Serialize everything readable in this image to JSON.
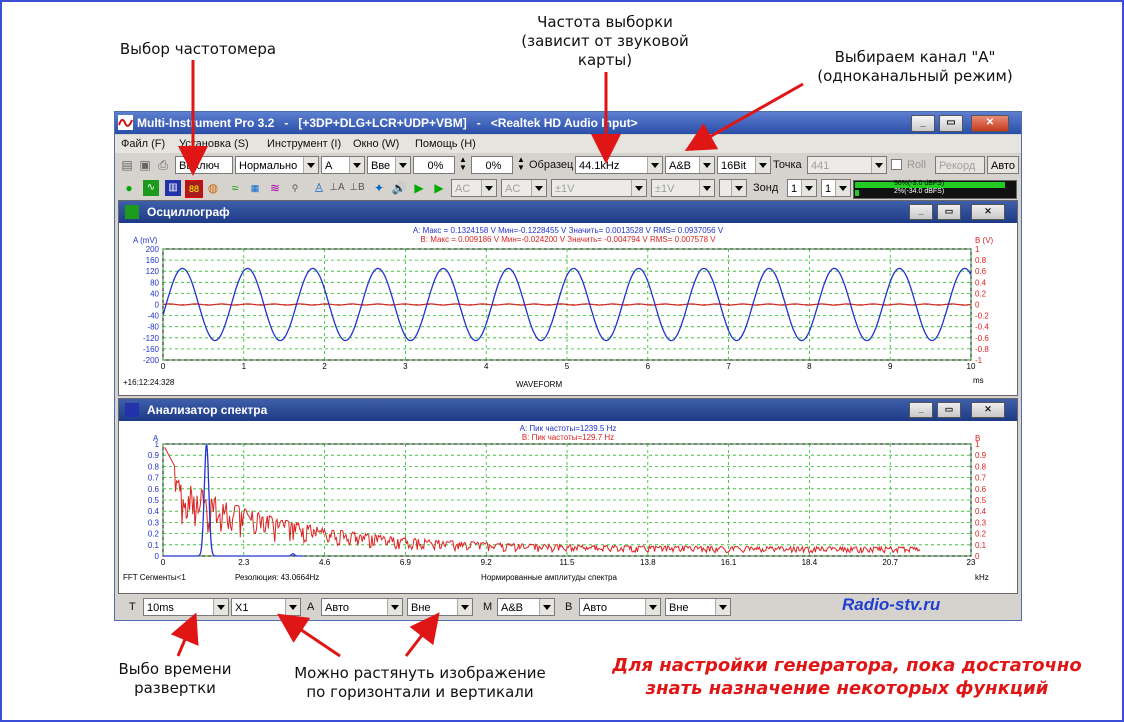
{
  "annotations": {
    "freq_meter": "Выбор частотомера",
    "sample_rate": [
      "Частота выборки",
      "(зависит от звуковой",
      "карты)"
    ],
    "channel": [
      "Выбираем канал \"А\"",
      "(одноканальный режим)"
    ],
    "timebase": [
      "Выбо времени",
      "развертки"
    ],
    "stretch": [
      "Можно растянуть изображение",
      "по горизонтали и вертикали"
    ],
    "note": [
      "Для настройки генератора, пока достаточно",
      "знать назначение некоторых функций"
    ],
    "site": "Radio-stv.ru"
  },
  "window": {
    "title": "Multi-Instrument Pro 3.2   -   [+3DP+DLG+LCR+UDP+VBM]   -   <Realtek HD Audio Input>"
  },
  "menu": [
    "Файл (F)",
    "Установка (S)",
    "Инструмент (I)",
    "Окно (W)",
    "Помощь (H)"
  ],
  "toolbar1": {
    "state": "Выключ",
    "mode": "Нормально",
    "channel_trig": "А",
    "edge": "Вве",
    "pct1": "0%",
    "pct2": "0%",
    "label_sample": "Образец",
    "sample_rate": "44.1kHz",
    "channel_mode": "A&B",
    "bits": "16Bit",
    "label_points": "Точка",
    "points": "441",
    "roll": "Roll",
    "record": "Рекорд",
    "auto": "Авто"
  },
  "toolbar2": {
    "ac1": "AC",
    "ac2": "AC",
    "range1": "±1V",
    "range2": "±1V",
    "label_probe": "Зонд",
    "probe1": "1",
    "probe2": "1",
    "meter_a": "96%(-3.0 dBFS)",
    "meter_b": "2%(-34.0 dBFS)"
  },
  "oscilloscope": {
    "title": "Осциллограф",
    "stats_a": "A:  Макс = 0.1324158 V  Мин=-0.1228455 V  Значить= 0.0013528 V  RMS= 0.0937056 V",
    "stats_b": "B:  Макс = 0.009186 V  Мин=-0.024200 V  Значить= -0.004794 V  RMS= 0.007578 V",
    "ylabel_a": "A (mV)",
    "ylabel_b": "B (V)",
    "xlabel": "WAVEFORM",
    "xunit": "ms",
    "timestamp": "+16:12:24:328",
    "logo": "MI"
  },
  "spectrum": {
    "title": "Анализатор спектра",
    "peak_a": "A: Пик частоты=1239.5 Hz",
    "peak_b": "B: Пик частоты=129.7 Hz",
    "ylabel_a": "A",
    "ylabel_b": "B",
    "fft_info": "FFT Сегменты<1",
    "resolution": "Резолюция: 43.0664Hz",
    "xlabel": "Нормированные амплитуды спектра",
    "xunit": "kHz",
    "logo": "MI"
  },
  "bottom": {
    "t_label": "T",
    "timebase": "10ms",
    "zoom": "X1",
    "a_label": "A",
    "a_scale": "Авто",
    "a_trig": "Вне",
    "m_label": "M",
    "m_mode": "A&B",
    "b_label": "B",
    "b_scale": "Авто",
    "b_trig": "Вне"
  },
  "chart_data": [
    {
      "type": "line",
      "title": "Осциллограф",
      "xlabel": "WAVEFORM",
      "ylabel": "A (mV)",
      "xlim": [
        0,
        10
      ],
      "x_ticks": [
        "0",
        "1",
        "2",
        "3",
        "4",
        "5",
        "6",
        "7",
        "8",
        "9",
        "10"
      ],
      "y_ticks_left": [
        "200",
        "160",
        "120",
        "80",
        "40",
        "0",
        "-40",
        "-80",
        "-120",
        "-160",
        "-200"
      ],
      "y_ticks_right": [
        "1",
        "0.8",
        "0.6",
        "0.4",
        "0.2",
        "0",
        "-0.2",
        "-0.4",
        "-0.6",
        "-0.8",
        "-1"
      ],
      "ylim": [
        -200,
        200
      ],
      "grid": true,
      "series": [
        {
          "name": "A",
          "color": "#2233cc",
          "freq_khz": 1.2395,
          "amplitude_mv": 130
        },
        {
          "name": "B",
          "color": "#dd2222",
          "amplitude_v": 0.01
        }
      ]
    },
    {
      "type": "line",
      "title": "Анализатор спектра",
      "xlabel": "Нормированные амплитуды спектра",
      "xlim": [
        0,
        23
      ],
      "x_ticks": [
        "0",
        "2.3",
        "4.6",
        "6.9",
        "9.2",
        "11.5",
        "13.8",
        "16.1",
        "18.4",
        "20.7",
        "23"
      ],
      "y_ticks": [
        "1",
        "0.9",
        "0.8",
        "0.7",
        "0.6",
        "0.5",
        "0.4",
        "0.3",
        "0.2",
        "0.1",
        "0"
      ],
      "ylim": [
        0,
        1
      ],
      "grid": true,
      "series": [
        {
          "name": "A",
          "color": "#2233cc",
          "peak_khz": 1.2395,
          "peak": 1.0
        },
        {
          "name": "B",
          "color": "#dd2222",
          "peak_khz": 0.1297,
          "peak": 1.0
        }
      ]
    }
  ]
}
